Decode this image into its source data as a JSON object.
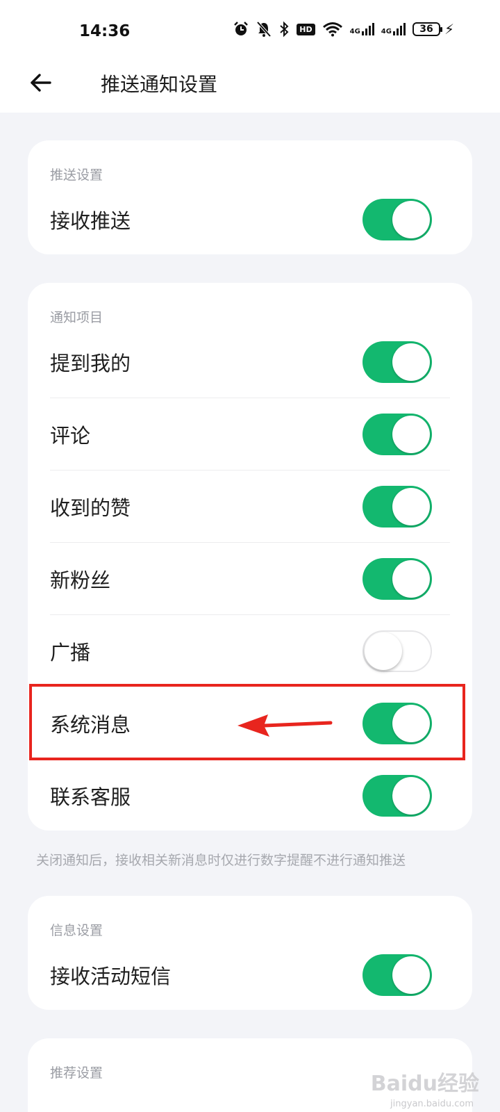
{
  "status_bar": {
    "time": "14:36",
    "network_badge": "HD",
    "signal_1": "4G",
    "signal_2": "4G",
    "battery_level": "36",
    "icons": [
      "alarm-icon",
      "mute-bell-icon",
      "bluetooth-icon",
      "hd-icon",
      "wifi-icon",
      "signal-4g-icon",
      "signal-4g-icon",
      "battery-icon",
      "charging-icon"
    ]
  },
  "header": {
    "title": "推送通知设置",
    "back_icon": "back-arrow-icon"
  },
  "sections": {
    "push": {
      "label": "推送设置",
      "items": [
        {
          "label": "接收推送",
          "on": true
        }
      ]
    },
    "notify": {
      "label": "通知项目",
      "items": [
        {
          "label": "提到我的",
          "on": true
        },
        {
          "label": "评论",
          "on": true
        },
        {
          "label": "收到的赞",
          "on": true
        },
        {
          "label": "新粉丝",
          "on": true
        },
        {
          "label": "广播",
          "on": false
        },
        {
          "label": "系统消息",
          "on": true
        },
        {
          "label": "联系客服",
          "on": true
        }
      ]
    },
    "footnote": "关闭通知后，接收相关新消息时仅进行数字提醒不进行通知推送",
    "message": {
      "label": "信息设置",
      "items": [
        {
          "label": "接收活动短信",
          "on": true
        }
      ]
    },
    "recommend": {
      "label": "推荐设置"
    }
  },
  "annotation": {
    "highlight_color": "#e8251e",
    "arrow_color": "#e8251e"
  },
  "colors": {
    "toggle_on": "#13b86f",
    "background": "#f3f4f8"
  },
  "watermark": {
    "text": "Baidu经验",
    "sub": "jingyan.baidu.com"
  }
}
